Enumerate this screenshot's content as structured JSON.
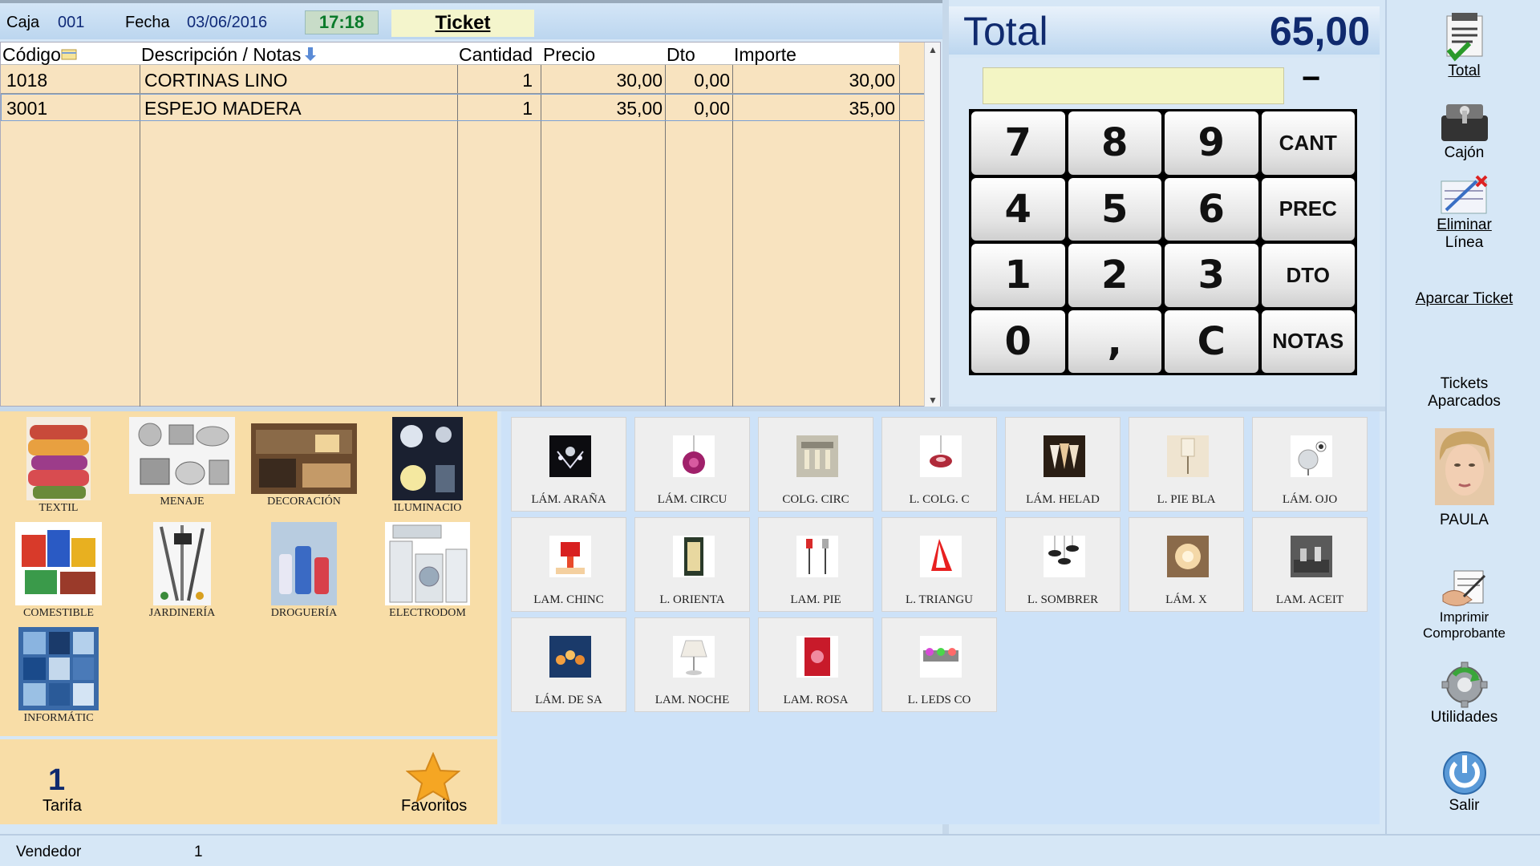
{
  "header": {
    "caja_label": "Caja",
    "caja_value": "001",
    "fecha_label": "Fecha",
    "fecha_value": "03/06/2016",
    "time": "17:18",
    "ticket_tab": "Ticket"
  },
  "table": {
    "columns": [
      "Código",
      "Descripción / Notas",
      "Cantidad",
      "Precio",
      "Dto",
      "Importe"
    ],
    "rows": [
      {
        "codigo": "1018",
        "descripcion": "CORTINAS LINO",
        "cantidad": "1",
        "precio": "30,00",
        "dto": "0,00",
        "importe": "30,00"
      },
      {
        "codigo": "3001",
        "descripcion": "ESPEJO MADERA",
        "cantidad": "1",
        "precio": "35,00",
        "dto": "0,00",
        "importe": "35,00"
      }
    ]
  },
  "total": {
    "label": "Total",
    "value": "65,00"
  },
  "keypad": {
    "minus": "−",
    "keys": [
      "7",
      "8",
      "9",
      "CANT",
      "4",
      "5",
      "6",
      "PREC",
      "1",
      "2",
      "3",
      "DTO",
      "0",
      ",",
      "C",
      "NOTAS"
    ]
  },
  "sidebar": {
    "total": "Total",
    "cajon": "Cajón",
    "eliminar_1": "Eliminar",
    "eliminar_2": "Línea",
    "aparcar": "Aparcar Ticket",
    "tickets_1": "Tickets",
    "tickets_2": "Aparcados",
    "user": "PAULA",
    "imprimir_1": "Imprimir",
    "imprimir_2": "Comprobante",
    "utilidades": "Utilidades",
    "salir": "Salir"
  },
  "categories": [
    "TEXTIL",
    "MENAJE",
    "DECORACIÓN",
    "ILUMINACIO",
    "COMESTIBLE",
    "JARDINERÍA",
    "DROGUERÍA",
    "ELECTRODOM",
    "INFORMÁTIC"
  ],
  "tarifa": {
    "number": "1",
    "label": "Tarifa"
  },
  "favoritos": "Favoritos",
  "products": [
    "LÁM. ARAÑA",
    "LÁM. CIRCU",
    "COLG. CIRC",
    "L. COLG. C",
    "LÁM. HELAD",
    "L. PIE BLA",
    "LÁM. OJO",
    "LAM. CHINC",
    "L. ORIENTA",
    "LAM. PIE",
    "L. TRIANGU",
    "L. SOMBRER",
    "LÁM. X",
    "LAM. ACEIT",
    "LÁM. DE SA",
    "LAM. NOCHE",
    "LAM. ROSA",
    "L. LEDS CO"
  ],
  "status": {
    "vendedor_label": "Vendedor",
    "vendedor_value": "1"
  }
}
